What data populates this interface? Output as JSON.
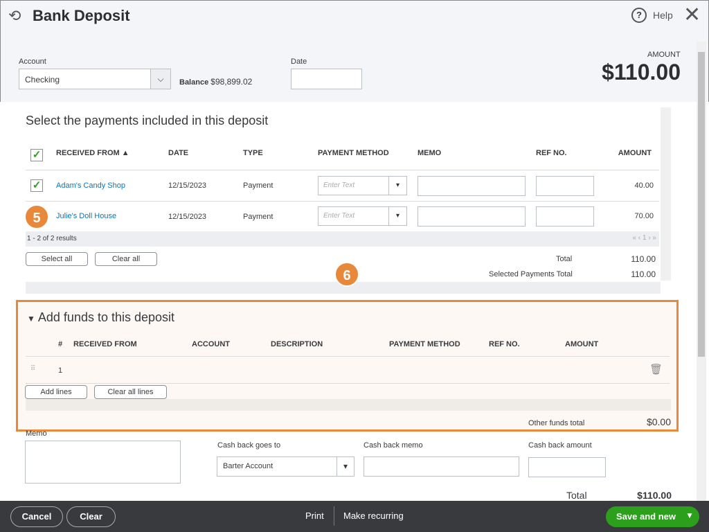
{
  "header": {
    "title": "Bank Deposit",
    "help": "Help",
    "amount_label": "AMOUNT",
    "amount": "$110.00"
  },
  "account": {
    "label": "Account",
    "value": "Checking",
    "balance_label": "Balance",
    "balance": "$98,899.02"
  },
  "date": {
    "label": "Date",
    "value": ""
  },
  "payments": {
    "title": "Select the payments included in this deposit",
    "columns": [
      "RECEIVED FROM",
      "DATE",
      "TYPE",
      "PAYMENT METHOD",
      "MEMO",
      "REF NO.",
      "AMOUNT"
    ],
    "rows": [
      {
        "from": "Adam's Candy Shop",
        "date": "12/15/2023",
        "type": "Payment",
        "method_placeholder": "Enter Text",
        "amount": "40.00",
        "checked": true
      },
      {
        "from": "Julie's Doll House",
        "date": "12/15/2023",
        "type": "Payment",
        "method_placeholder": "Enter Text",
        "amount": "70.00",
        "checked": false
      }
    ],
    "results": "1 - 2 of 2 results",
    "select_all": "Select all",
    "clear_all": "Clear all",
    "total_label": "Total",
    "total": "110.00",
    "selected_label": "Selected Payments Total",
    "selected_total": "110.00"
  },
  "funds": {
    "title": "Add funds to this deposit",
    "columns": [
      "#",
      "RECEIVED FROM",
      "ACCOUNT",
      "DESCRIPTION",
      "PAYMENT METHOD",
      "REF NO.",
      "AMOUNT"
    ],
    "row_num": "1",
    "add_lines": "Add lines",
    "clear_lines": "Clear all lines",
    "other_label": "Other funds total",
    "other_total": "$0.00"
  },
  "bottom": {
    "memo_label": "Memo",
    "cashback_to_label": "Cash back goes to",
    "cashback_to": "Barter Account",
    "cashback_memo_label": "Cash back memo",
    "cashback_amount_label": "Cash back amount",
    "total_label": "Total",
    "total": "$110.00"
  },
  "markers": {
    "m5": "5",
    "m6": "6"
  },
  "footer": {
    "cancel": "Cancel",
    "clear": "Clear",
    "print": "Print",
    "recurring": "Make recurring",
    "save": "Save and new"
  },
  "colors": {
    "accent": "#2ca01c",
    "highlight": "#e8883a",
    "link": "#0077c5"
  }
}
